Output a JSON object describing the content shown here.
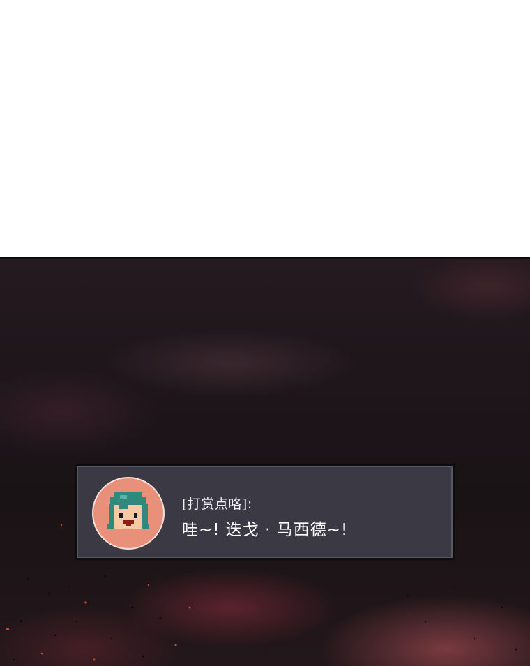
{
  "dialog": {
    "speaker": "[打赏点咯]:",
    "message": "哇~! 迭戈 · 马西德~!",
    "avatar_icon": "pixel-character-avatar-icon"
  },
  "colors": {
    "dialog_background": "#3b3a44",
    "dialog_border": "#0d0c0f",
    "avatar_background": "#e8907a",
    "scene_background": "#1d1519"
  }
}
